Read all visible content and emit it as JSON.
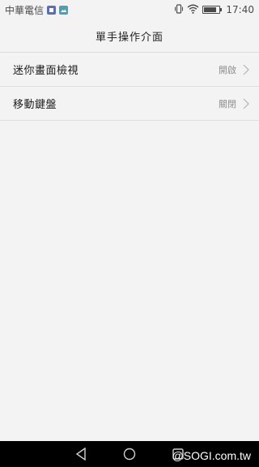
{
  "status_bar": {
    "carrier": "中華電信",
    "time": "17:40",
    "battery_level": 0.8,
    "icons": [
      "notification-app-icon",
      "notification-image-icon",
      "vibrate-icon",
      "wifi-icon",
      "battery-icon"
    ]
  },
  "header": {
    "title": "單手操作介面"
  },
  "settings": [
    {
      "label": "迷你畫面檢視",
      "value": "開啟"
    },
    {
      "label": "移動鍵盤",
      "value": "關閉"
    }
  ],
  "nav_bar": {
    "icons": [
      "back-icon",
      "home-icon",
      "recents-icon"
    ]
  },
  "watermark": "@SOGI.com.tw",
  "colors": {
    "background": "#f3f3f3",
    "divider": "#dedede",
    "value_text": "#8f8f8f",
    "nav_bar": "#000000"
  }
}
